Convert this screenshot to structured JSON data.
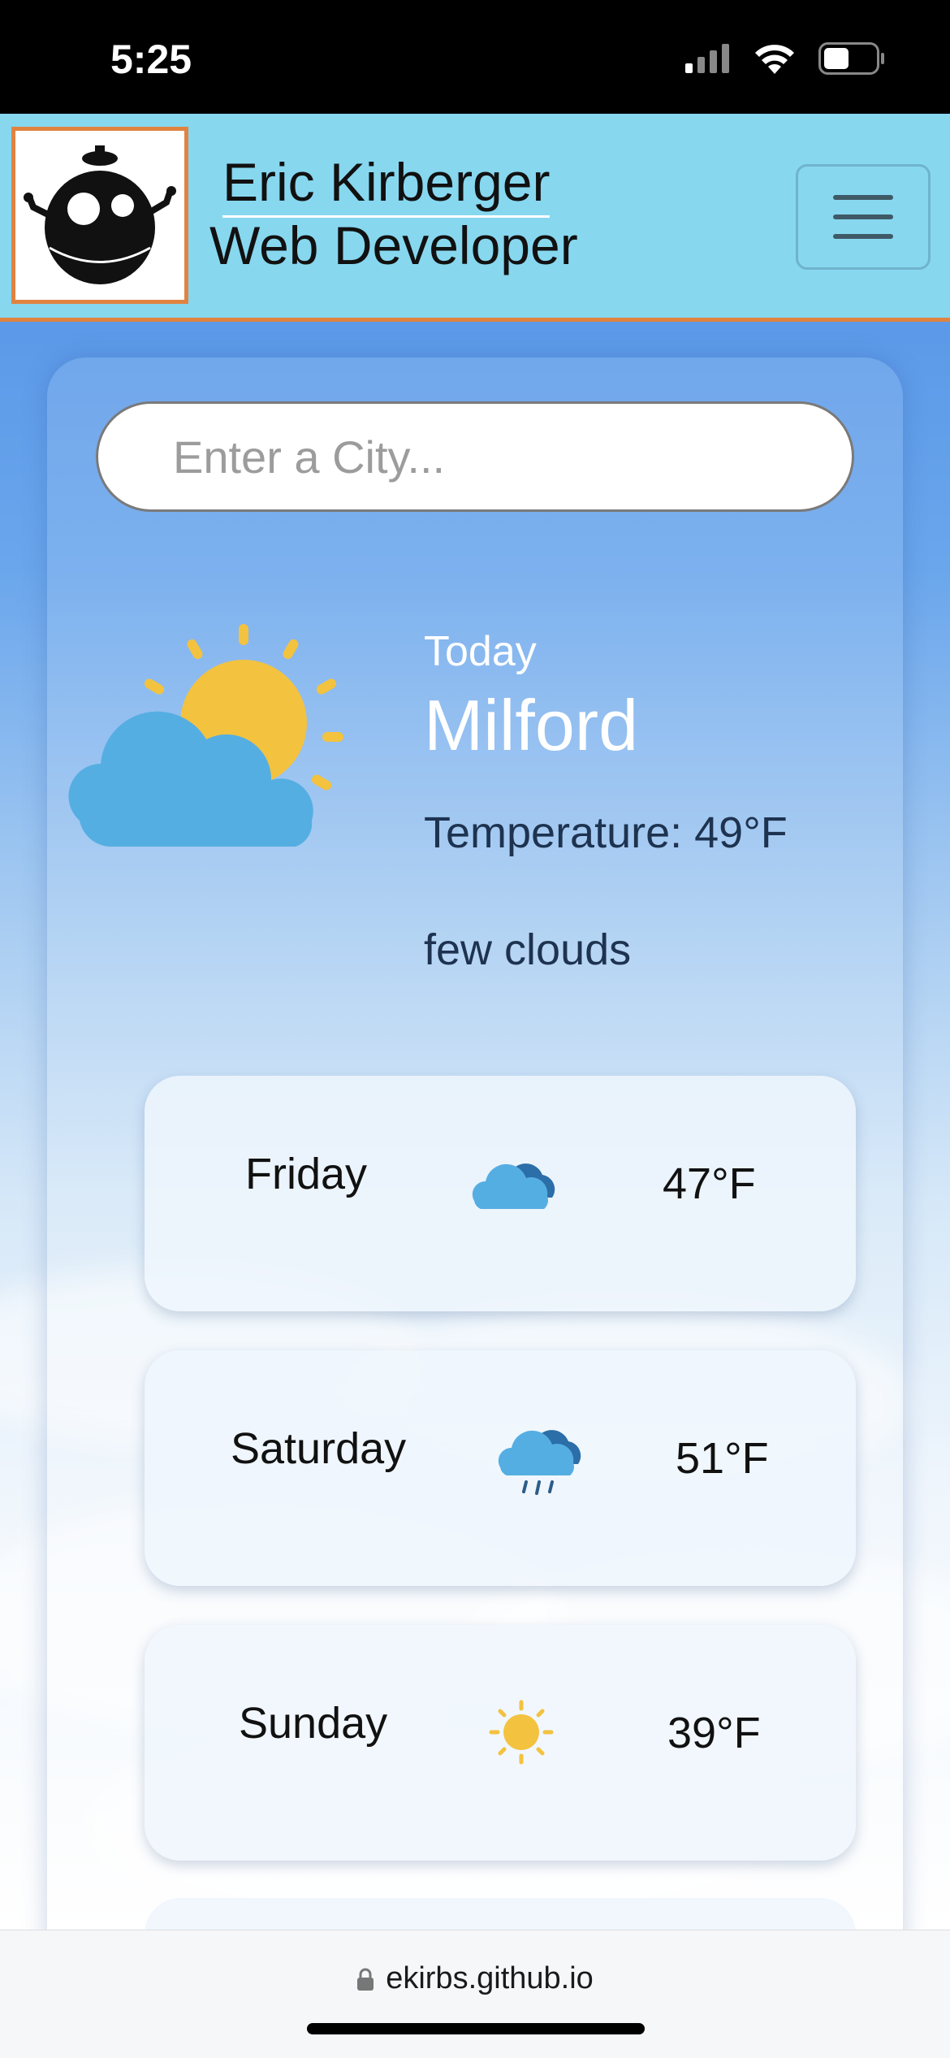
{
  "status_bar": {
    "time": "5:25"
  },
  "header": {
    "name": "Eric Kirberger",
    "role": "Web Developer",
    "logo_icon": "robot-logo-icon",
    "menu_icon": "hamburger-menu-icon"
  },
  "search": {
    "placeholder": "Enter a City...",
    "value": ""
  },
  "today": {
    "label": "Today",
    "city": "Milford",
    "temperature": "Temperature: 49°F",
    "description": "few clouds",
    "icon": "partly-cloudy-icon"
  },
  "forecast": [
    {
      "day": "Friday",
      "temp": "47°F",
      "icon": "cloudy-icon"
    },
    {
      "day": "Saturday",
      "temp": "51°F",
      "icon": "rain-icon"
    },
    {
      "day": "Sunday",
      "temp": "39°F",
      "icon": "sun-icon"
    }
  ],
  "browser": {
    "url": "ekirbs.github.io"
  },
  "colors": {
    "header_bg": "#87d7ef",
    "accent_orange": "#e08340",
    "sun_yellow": "#f3c23f",
    "cloud_blue": "#55aee2",
    "cloud_dark": "#2b6ea8"
  }
}
